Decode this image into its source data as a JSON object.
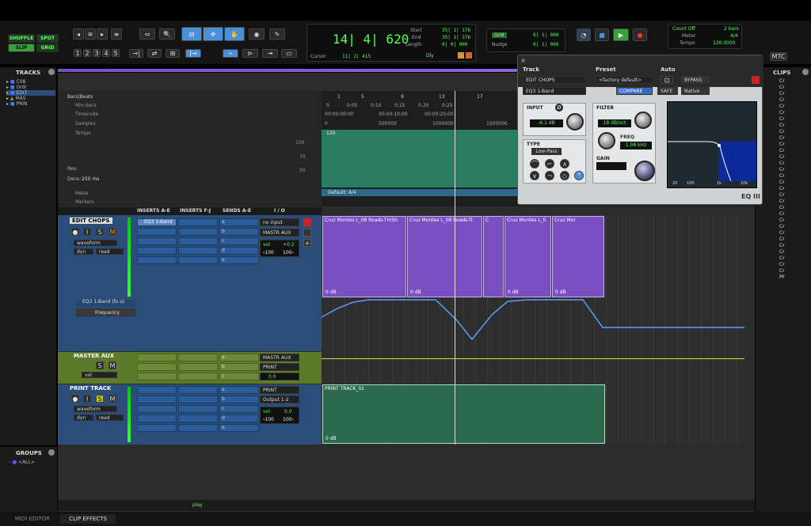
{
  "colors": {
    "accent_green": "#5f5",
    "purple_clip": "#7a4fc2",
    "green_clip": "#2c6a4e",
    "blue_track": "#2a4d7a",
    "olive_track": "#5b7a2a",
    "eq_blue": "#0a2a9a"
  },
  "modes": {
    "shuffle": "SHUFFLE",
    "spot": "SPOT",
    "slip": "SLIP",
    "grid": "GRID"
  },
  "zoom_presets": [
    "1",
    "2",
    "3",
    "4",
    "5"
  ],
  "counter": {
    "main": "14| 4| 620",
    "start_label": "Start",
    "end_label": "End",
    "length_label": "Length",
    "start": "35| 1| 376",
    "end": "35| 1| 376",
    "length": "0| 0| 000",
    "cursor_label": "Cursor",
    "cursor": "11| 2| 415",
    "dly": "Dly"
  },
  "grid": {
    "grid_label": "Grid",
    "grid_value": "0| 1| 000",
    "nudge_label": "Nudge",
    "nudge_value": "0| 1| 000"
  },
  "transport_info": {
    "count_off": "Count Off",
    "bars": "2 bars",
    "meter_label": "Meter",
    "meter": "4/4",
    "tempo_label": "Tempo",
    "tempo": "120.0000",
    "mtc": "MTC"
  },
  "tracks_panel": {
    "title": "TRACKS",
    "items": [
      "C08",
      "Ordr",
      "EDIT",
      "MAS",
      "PRIN"
    ]
  },
  "groups_panel": {
    "title": "GROUPS",
    "items": [
      "<ALL>"
    ]
  },
  "clips_panel": {
    "title": "CLIPS",
    "items": [
      "Cr",
      "Cr",
      "Cr",
      "Cr",
      "Cr",
      "Cr",
      "Cr",
      "Cr",
      "Cr",
      "Cr",
      "Cr",
      "Cr",
      "Cr",
      "Cr",
      "Cr",
      "Cr",
      "Cr",
      "Cr",
      "Cr",
      "Cr",
      "Cr",
      "Cr",
      "Cr",
      "Cr",
      "Cr",
      "Cr",
      "Cr",
      "Cr",
      "Cr",
      "Cr",
      "Cr",
      "PF"
    ]
  },
  "rulers": {
    "labels": [
      "Bars|Beats",
      "Min:Secs",
      "Timecode",
      "Samples",
      "Tempo",
      "Meter",
      "Markers"
    ],
    "bars": [
      "1",
      "5",
      "9",
      "13",
      "17"
    ],
    "minsecs": [
      "0",
      "0:05",
      "0:10",
      "0:15",
      "0:20",
      "0:25"
    ],
    "timecode": [
      "00:00:00:00",
      "00:00:10:00",
      "00:00:20:00"
    ],
    "samples": [
      "0",
      "500000",
      "1000000",
      "1500000"
    ],
    "tempo_value": "120",
    "tempo_scale": [
      "100",
      "70",
      "50"
    ],
    "meter_value": "Default: 4/4",
    "res_label": "Res:",
    "dens_label": "Dens:",
    "dens_value": "250 ms"
  },
  "columns": {
    "inserts_ae": "INSERTS A-E",
    "inserts_fj": "INSERTS F-J",
    "sends_ae": "SENDS A-E",
    "io": "I / O"
  },
  "tracks": {
    "edit": {
      "name": "EDIT CHOPS",
      "view": "waveform",
      "auto": "dyn",
      "read": "read",
      "insert": "EQ3 1-Band",
      "send_letters": [
        "a",
        "b",
        "c",
        "d",
        "e"
      ],
      "input": "no input",
      "output": "MASTR AUX",
      "vol_label": "vol",
      "vol_value": "+0.2",
      "pan_l": "‹100",
      "pan_r": "100›",
      "fx_lane": "EQ3 1-Band (fx a)",
      "fx_param": "Frequency"
    },
    "master": {
      "name": "MASTER AUX",
      "input": "MASTR AUX",
      "output": "PRINT",
      "vol_label": "vol",
      "vol_value": "0.0",
      "send_letters": [
        "a",
        "b",
        "c"
      ]
    },
    "print": {
      "name": "PRINT TRACK",
      "view": "waveform",
      "auto": "dyn",
      "read": "read",
      "input": "PRINT",
      "output": "Output 1-2",
      "vol_label": "vol",
      "vol_value": "0.0",
      "pan_l": "‹100",
      "pan_r": "100›",
      "send_letters": [
        "a",
        "b",
        "c",
        "d",
        "e"
      ]
    }
  },
  "clips": {
    "edit": [
      {
        "name": "Cruz Montes L_08 Roads-TmSh",
        "gain": "0 dB"
      },
      {
        "name": "Cruz Montes L_08 Roads-Tr",
        "gain": "0 dB"
      },
      {
        "name": "C",
        "gain": ""
      },
      {
        "name": "Cruz Montes L_0",
        "gain": "0 dB"
      },
      {
        "name": "Cruz Mor",
        "gain": "0 dB"
      }
    ],
    "print": {
      "name": "PRINT TRACK_01",
      "gain": "0 dB"
    }
  },
  "plugin": {
    "track_label": "Track",
    "preset_label": "Preset",
    "auto_label": "Auto",
    "track_name": "EDIT CHOPS",
    "preset_name": "<factory default>",
    "insert_name": "EQ3 1-Band",
    "compare": "COMPARE",
    "bypass": "BYPASS",
    "safe": "SAFE",
    "native": "Native",
    "input_label": "INPUT",
    "input_value": "-6.1 dB",
    "filter_label": "FILTER",
    "filter_slope": "18 dB/oct",
    "freq_label": "FREQ",
    "freq_value": "1.08 kHz",
    "type_label": "TYPE",
    "type_value": "Low-Pass",
    "gain_label": "GAIN",
    "phase_label": "Ø",
    "graph_labels": [
      "20",
      "100",
      "1k",
      "10k"
    ],
    "logo": "EQ III"
  },
  "bottom": {
    "midi_editor": "MIDI EDITOR",
    "clip_effects": "CLIP EFFECTS",
    "play": "play"
  }
}
